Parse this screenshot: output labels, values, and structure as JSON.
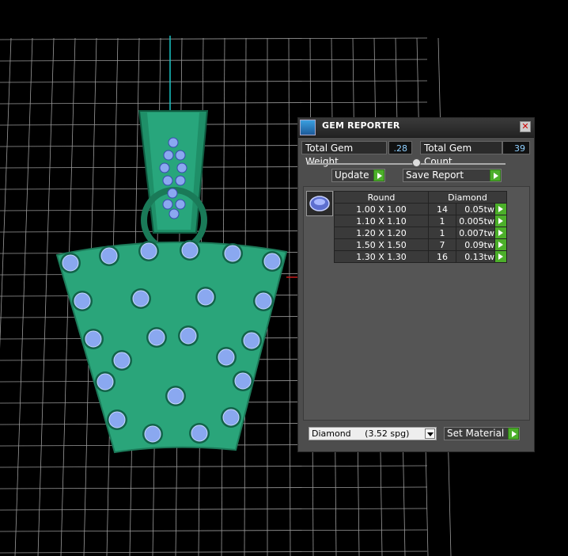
{
  "window": {
    "title": "GEM REPORTER",
    "close_icon": "close-icon"
  },
  "stats": {
    "total_weight_label": "Total Gem Weight",
    "total_weight_value": ".28",
    "total_count_label": "Total Gem Count",
    "total_count_value": "39"
  },
  "buttons": {
    "update": "Update",
    "save_report": "Save Report",
    "set_material": "Set Material"
  },
  "table": {
    "headers": [
      "Round",
      "Diamond"
    ],
    "rows": [
      {
        "size": "1.00 X 1.00",
        "count": "14",
        "weight": "0.05tw"
      },
      {
        "size": "1.10 X 1.10",
        "count": "1",
        "weight": "0.005tw"
      },
      {
        "size": "1.20 X 1.20",
        "count": "1",
        "weight": "0.007tw"
      },
      {
        "size": "1.50 X 1.50",
        "count": "7",
        "weight": "0.09tw"
      },
      {
        "size": "1.30 X 1.30",
        "count": "16",
        "weight": "0.13tw"
      }
    ]
  },
  "material": {
    "selected": "Diamond     (3.52 spg)"
  },
  "colors": {
    "metal": "#2aa57a",
    "gem": "#8aa8f0",
    "grid": "#9a9a9a",
    "panel": "#4d4d4d",
    "accent": "#4caf2a"
  }
}
